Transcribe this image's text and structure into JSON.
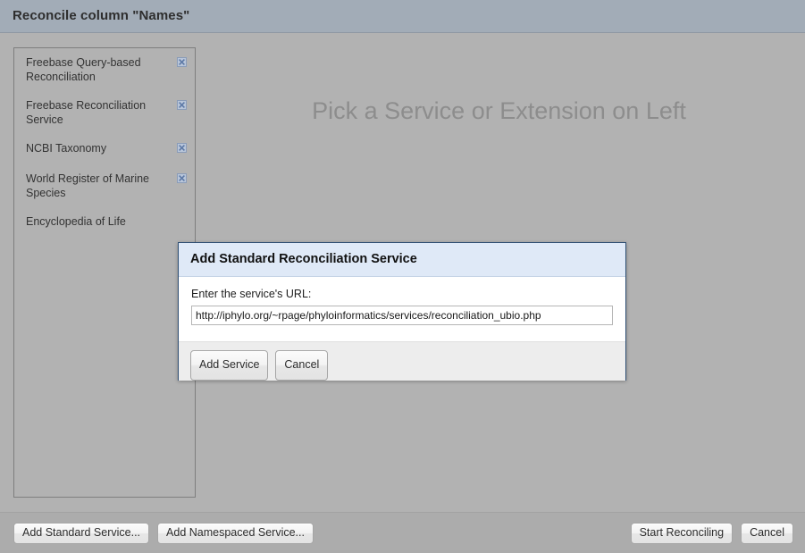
{
  "header": {
    "title": "Reconcile column \"Names\""
  },
  "sidebar": {
    "services": [
      {
        "label": "Freebase Query-based Reconciliation",
        "removable": true,
        "remove_icon": "delete-x-icon"
      },
      {
        "label": "Freebase Reconciliation Service",
        "removable": true,
        "remove_icon": "delete-x-icon"
      },
      {
        "label": "NCBI Taxonomy",
        "removable": true,
        "remove_icon": "delete-x-icon"
      },
      {
        "label": "World Register of Marine Species",
        "removable": true,
        "remove_icon": "delete-x-icon"
      },
      {
        "label": "Encyclopedia of Life",
        "removable": false,
        "remove_icon": ""
      }
    ]
  },
  "main": {
    "placeholder": "Pick a Service or Extension on Left"
  },
  "modal": {
    "title": "Add Standard Reconciliation Service",
    "field_label": "Enter the service's URL:",
    "url_value": "http://iphylo.org/~rpage/phyloinformatics/services/reconciliation_ubio.php",
    "url_placeholder": "",
    "add_label": "Add Service",
    "cancel_label": "Cancel"
  },
  "footer": {
    "add_standard_label": "Add Standard Service...",
    "add_namespaced_label": "Add Namespaced Service...",
    "start_label": "Start Reconciling",
    "cancel_label": "Cancel"
  },
  "colors": {
    "header_bg": "#a2acb7",
    "page_bg": "#b2b2b2",
    "modal_title_bg": "#dfe9f7",
    "modal_border": "#2f4f73",
    "placeholder_text": "#8d8d8d",
    "remove_icon": "#7c93b8"
  }
}
